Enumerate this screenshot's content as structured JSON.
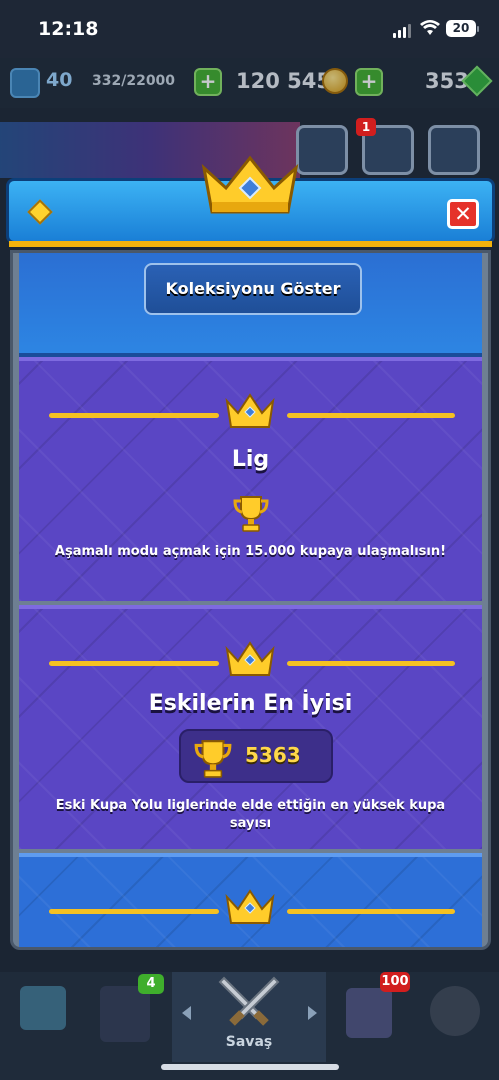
{
  "status_bar": {
    "time": "12:18",
    "battery": "20"
  },
  "top_bar": {
    "level": "40",
    "xp": "332/22000",
    "gold": "120 545",
    "gems": "353"
  },
  "hud": {
    "notification_count": "1"
  },
  "popup": {
    "collection_button": "Koleksiyonu Göster",
    "close_label": "✕",
    "league": {
      "title": "Lig",
      "description": "Aşamalı modu açmak için 15.000 kupaya ulaşmalısın!"
    },
    "best_of_old": {
      "title": "Eskilerin En İyisi",
      "trophies": "5363",
      "description": "Eski Kupa Yolu liglerinde elde ettiğin en yüksek kupa sayısı"
    }
  },
  "bottom_nav": {
    "cards_badge": "4",
    "clan_badge": "100",
    "battle_label": "Savaş"
  },
  "colors": {
    "accent_gold": "#f5c122",
    "panel_purple": "#5a46c4",
    "panel_blue": "#2d6fd7",
    "close_red": "#e5322a"
  },
  "icons": [
    "crown-icon",
    "trophy-icon",
    "gold-coin-icon",
    "gem-icon",
    "close-icon",
    "swords-icon"
  ]
}
